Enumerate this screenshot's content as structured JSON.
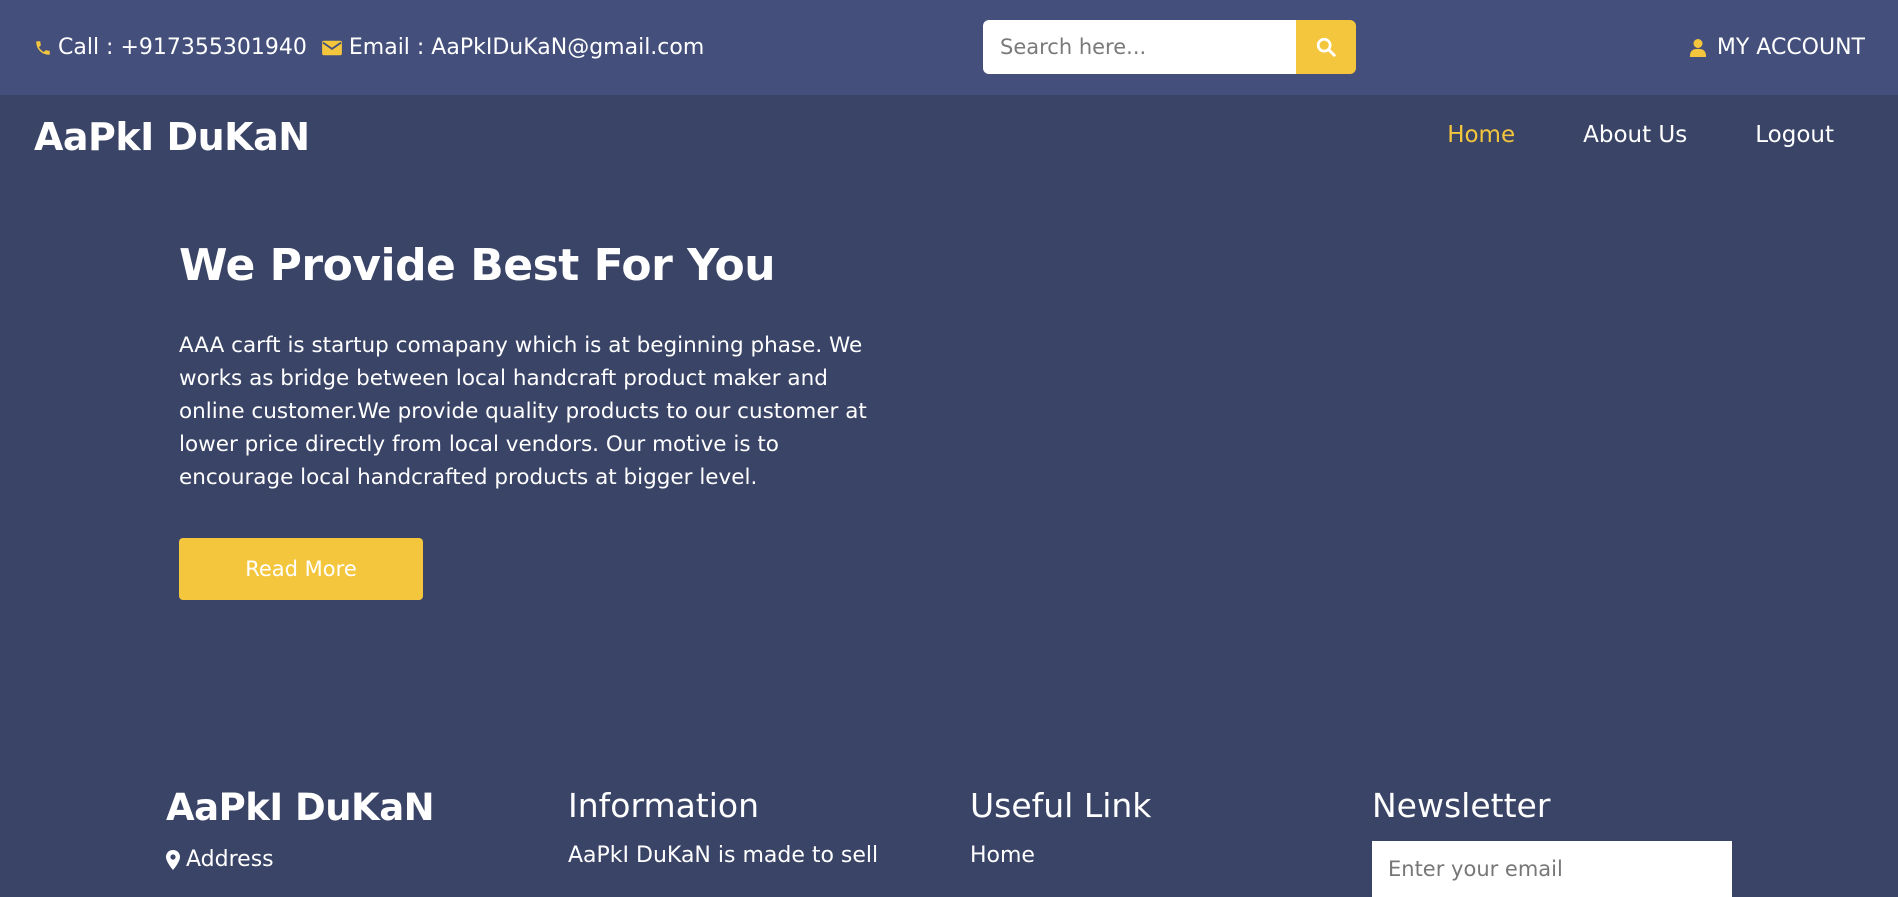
{
  "topbar": {
    "call_text": "Call : +917355301940",
    "email_text": "Email : AaPkIDuKaN@gmail.com",
    "search_placeholder": "Search here...",
    "account_label": "MY ACCOUNT"
  },
  "nav": {
    "brand": "AaPkI DuKaN",
    "items": [
      {
        "label": "Home",
        "active": true
      },
      {
        "label": "About Us",
        "active": false
      },
      {
        "label": "Logout",
        "active": false
      }
    ]
  },
  "hero": {
    "title": "We Provide Best For You",
    "body": "AAA carft is startup comapany which is at beginning phase. We works as bridge between local handcraft product maker and online customer.We provide quality products to our customer at lower price directly from local vendors. Our motive is to encourage local handcrafted products at bigger level.",
    "button_label": "Read More"
  },
  "footer": {
    "brand": "AaPkI DuKaN",
    "address_label": "Address",
    "information_title": "Information",
    "information_text": "AaPkI DuKaN is made to sell",
    "useful_link_title": "Useful Link",
    "useful_link_first": "Home",
    "newsletter_title": "Newsletter",
    "newsletter_placeholder": "Enter your email"
  },
  "colors": {
    "background": "#3a4467",
    "topbar": "#44507b",
    "accent": "#f4c63d",
    "text": "#ffffff"
  },
  "icons": {
    "call": "phone-icon",
    "email": "envelope-icon",
    "search": "search-icon",
    "account": "user-icon",
    "address": "map-marker-icon"
  }
}
